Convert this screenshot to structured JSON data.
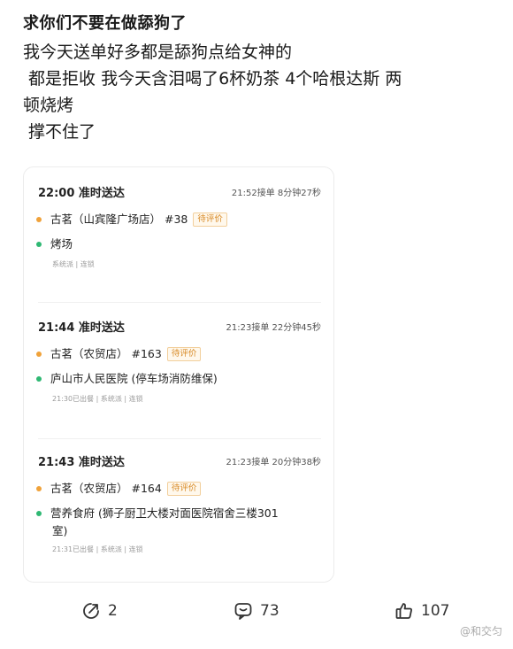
{
  "post": {
    "title": "求你们不要在做舔狗了",
    "lines": [
      "我今天送单好多都是舔狗点给女神的",
      " 都是拒收 我今天含泪喝了6杯奶茶 4个哈根达斯 两",
      "顿烧烤",
      " 撑不住了"
    ]
  },
  "orders": [
    {
      "time": "22:00 准时送达",
      "meta": "21:52接单 8分钟27秒",
      "shop": "古茗（山宾隆广场店） #38",
      "badge": "待评价",
      "dest": "烤场",
      "dest2": "",
      "tags": "系统派 | 连锁"
    },
    {
      "time": "21:44 准时送达",
      "meta": "21:23接单 22分钟45秒",
      "shop": "古茗（农贸店） #163",
      "badge": "待评价",
      "dest": "庐山市人民医院 (停车场消防维保)",
      "dest2": "",
      "tags": "21:30已出餐 | 系统派 | 连锁"
    },
    {
      "time": "21:43 准时送达",
      "meta": "21:23接单 20分钟38秒",
      "shop": "古茗（农贸店） #164",
      "badge": "待评价",
      "dest": "营养食府 (狮子厨卫大楼对面医院宿舍三楼301",
      "dest2": "室)",
      "tags": "21:31已出餐 | 系统派 | 连锁"
    }
  ],
  "actions": {
    "share_count": "2",
    "comment_count": "73",
    "like_count": "107"
  },
  "watermark": "@和交匀",
  "colors": {
    "dot_pickup": "#f0a23a",
    "dot_dropoff": "#2fb873",
    "badge_text": "#d88a26"
  }
}
